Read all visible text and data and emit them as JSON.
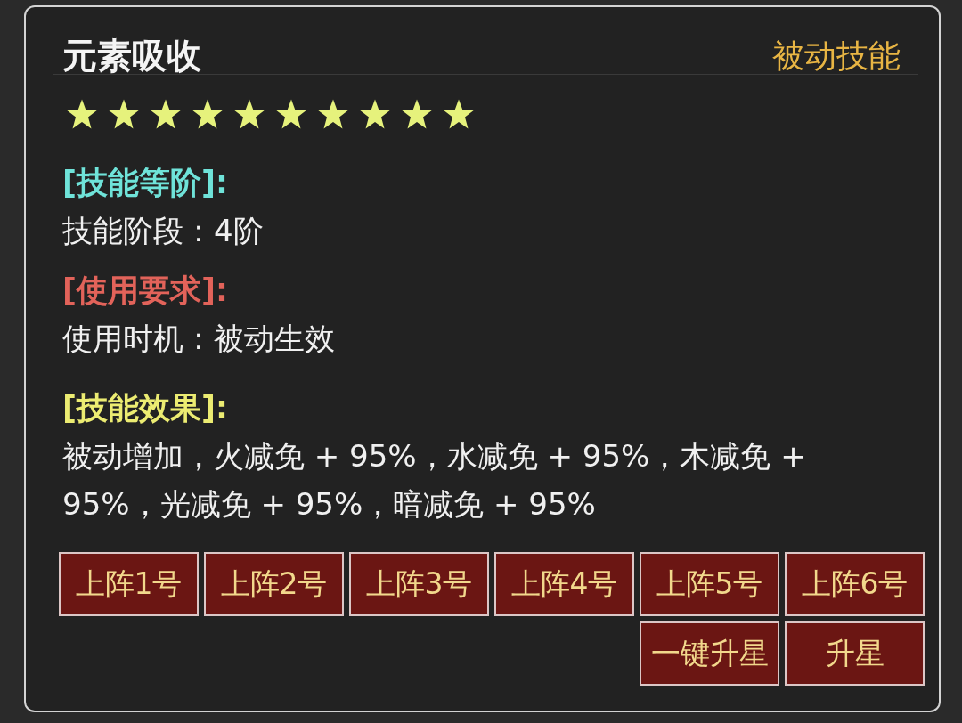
{
  "skill": {
    "name": "元素吸收",
    "type_label": "被动技能",
    "stars": 10,
    "sections": [
      {
        "heading": "[技能等阶]:",
        "color": "#6fe3d9",
        "text": "技能阶段：4阶"
      },
      {
        "heading": "[使用要求]:",
        "color": "#e2635a",
        "text": "使用时机：被动生效"
      },
      {
        "heading": "[技能效果]:",
        "color": "#ecec72",
        "text": "被动增加，火减免 + 95%，水减免 + 95%，木减免 + 95%，光减免 + 95%，暗减免 + 95%"
      }
    ]
  },
  "button_rows": [
    [
      "上阵1号",
      "上阵2号",
      "上阵3号",
      "上阵4号",
      "上阵5号",
      "上阵6号"
    ],
    [
      "一键升星",
      "升星"
    ]
  ]
}
